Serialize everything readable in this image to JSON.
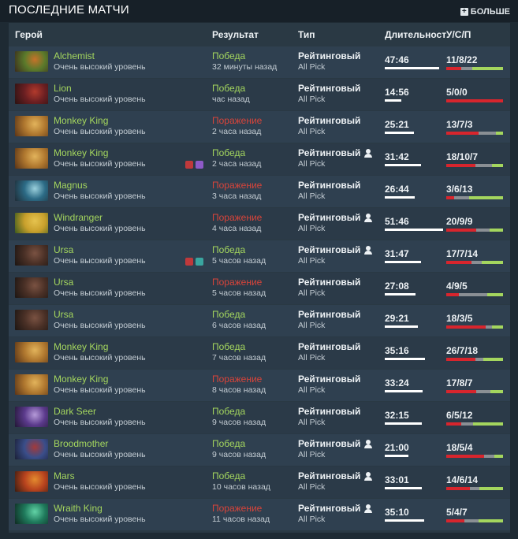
{
  "header": {
    "title": "ПОСЛЕДНИЕ МАТЧИ",
    "more_label": "БОЛЬШЕ"
  },
  "columns": {
    "hero": "Герой",
    "result": "Результат",
    "type": "Тип",
    "duration": "Длительность",
    "kda": "У/С/П"
  },
  "colors": {
    "win": "#a4d65e",
    "loss": "#d9443a",
    "kills": "#d8252d",
    "deaths": "#8a8f94",
    "assists": "#a4d65e"
  },
  "matches": [
    {
      "hero": "Alchemist",
      "skill": "Очень высокий уровень",
      "result": "Победа",
      "outcome": "win",
      "ago": "32 минуты назад",
      "type": "Рейтинговый",
      "party": false,
      "mode": "All Pick",
      "duration": "47:46",
      "duration_fraction": 0.93,
      "kda": "11/8/22",
      "k": 11,
      "d": 8,
      "a": 22,
      "items": [],
      "hero_colors": [
        "#5a7a2b",
        "#c7722a",
        "#3b2c1c"
      ]
    },
    {
      "hero": "Lion",
      "skill": "Очень высокий уровень",
      "result": "Победа",
      "outcome": "win",
      "ago": "час назад",
      "type": "Рейтинговый",
      "party": false,
      "mode": "All Pick",
      "duration": "14:56",
      "duration_fraction": 0.29,
      "kda": "5/0/0",
      "k": 5,
      "d": 0,
      "a": 0,
      "items": [],
      "hero_colors": [
        "#6b1f22",
        "#b23a2c",
        "#2a1212"
      ]
    },
    {
      "hero": "Monkey King",
      "skill": "Очень высокий уровень",
      "result": "Поражение",
      "outcome": "loss",
      "ago": "2 часа назад",
      "type": "Рейтинговый",
      "party": false,
      "mode": "All Pick",
      "duration": "25:21",
      "duration_fraction": 0.5,
      "kda": "13/7/3",
      "k": 13,
      "d": 7,
      "a": 3,
      "items": [],
      "hero_colors": [
        "#b0782f",
        "#e2b35b",
        "#5a3417"
      ]
    },
    {
      "hero": "Monkey King",
      "skill": "Очень высокий уровень",
      "result": "Победа",
      "outcome": "win",
      "ago": "2 часа назад",
      "type": "Рейтинговый",
      "party": true,
      "mode": "All Pick",
      "duration": "31:42",
      "duration_fraction": 0.62,
      "kda": "18/10/7",
      "k": 18,
      "d": 10,
      "a": 7,
      "items": [
        "#c0393b",
        "#8e5ac8"
      ],
      "hero_colors": [
        "#b0782f",
        "#e2b35b",
        "#5a3417"
      ]
    },
    {
      "hero": "Magnus",
      "skill": "Очень высокий уровень",
      "result": "Поражение",
      "outcome": "loss",
      "ago": "3 часа назад",
      "type": "Рейтинговый",
      "party": false,
      "mode": "All Pick",
      "duration": "26:44",
      "duration_fraction": 0.52,
      "kda": "3/6/13",
      "k": 3,
      "d": 6,
      "a": 13,
      "items": [],
      "hero_colors": [
        "#2c6b86",
        "#9ad0dc",
        "#1f2c36"
      ]
    },
    {
      "hero": "Windranger",
      "skill": "Очень высокий уровень",
      "result": "Поражение",
      "outcome": "loss",
      "ago": "4 часа назад",
      "type": "Рейтинговый",
      "party": true,
      "mode": "All Pick",
      "duration": "51:46",
      "duration_fraction": 1.0,
      "kda": "20/9/9",
      "k": 20,
      "d": 9,
      "a": 9,
      "items": [],
      "hero_colors": [
        "#c9a02c",
        "#e6c34f",
        "#3c5a1d"
      ]
    },
    {
      "hero": "Ursa",
      "skill": "Очень высокий уровень",
      "result": "Победа",
      "outcome": "win",
      "ago": "5 часов назад",
      "type": "Рейтинговый",
      "party": true,
      "mode": "All Pick",
      "duration": "31:47",
      "duration_fraction": 0.62,
      "kda": "17/7/14",
      "k": 17,
      "d": 7,
      "a": 14,
      "items": [
        "#c0393b",
        "#3aa6a0"
      ],
      "hero_colors": [
        "#4a3026",
        "#7a5242",
        "#1c1512"
      ]
    },
    {
      "hero": "Ursa",
      "skill": "Очень высокий уровень",
      "result": "Поражение",
      "outcome": "loss",
      "ago": "5 часов назад",
      "type": "Рейтинговый",
      "party": false,
      "mode": "All Pick",
      "duration": "27:08",
      "duration_fraction": 0.53,
      "kda": "4/9/5",
      "k": 4,
      "d": 9,
      "a": 5,
      "items": [],
      "hero_colors": [
        "#4a3026",
        "#7a5242",
        "#1c1512"
      ]
    },
    {
      "hero": "Ursa",
      "skill": "Очень высокий уровень",
      "result": "Победа",
      "outcome": "win",
      "ago": "6 часов назад",
      "type": "Рейтинговый",
      "party": false,
      "mode": "All Pick",
      "duration": "29:21",
      "duration_fraction": 0.57,
      "kda": "18/3/5",
      "k": 18,
      "d": 3,
      "a": 5,
      "items": [],
      "hero_colors": [
        "#4a3026",
        "#7a5242",
        "#1c1512"
      ]
    },
    {
      "hero": "Monkey King",
      "skill": "Очень высокий уровень",
      "result": "Победа",
      "outcome": "win",
      "ago": "7 часов назад",
      "type": "Рейтинговый",
      "party": false,
      "mode": "All Pick",
      "duration": "35:16",
      "duration_fraction": 0.69,
      "kda": "26/7/18",
      "k": 26,
      "d": 7,
      "a": 18,
      "items": [],
      "hero_colors": [
        "#b0782f",
        "#e2b35b",
        "#5a3417"
      ]
    },
    {
      "hero": "Monkey King",
      "skill": "Очень высокий уровень",
      "result": "Поражение",
      "outcome": "loss",
      "ago": "8 часов назад",
      "type": "Рейтинговый",
      "party": false,
      "mode": "All Pick",
      "duration": "33:24",
      "duration_fraction": 0.65,
      "kda": "17/8/7",
      "k": 17,
      "d": 8,
      "a": 7,
      "items": [],
      "hero_colors": [
        "#b0782f",
        "#e2b35b",
        "#5a3417"
      ]
    },
    {
      "hero": "Dark Seer",
      "skill": "Очень высокий уровень",
      "result": "Победа",
      "outcome": "win",
      "ago": "9 часов назад",
      "type": "Рейтинговый",
      "party": false,
      "mode": "All Pick",
      "duration": "32:15",
      "duration_fraction": 0.63,
      "kda": "6/5/12",
      "k": 6,
      "d": 5,
      "a": 12,
      "items": [],
      "hero_colors": [
        "#5b3a8c",
        "#b59ad8",
        "#221634"
      ]
    },
    {
      "hero": "Broodmother",
      "skill": "Очень высокий уровень",
      "result": "Победа",
      "outcome": "win",
      "ago": "9 часов назад",
      "type": "Рейтинговый",
      "party": true,
      "mode": "All Pick",
      "duration": "21:00",
      "duration_fraction": 0.41,
      "kda": "18/5/4",
      "k": 18,
      "d": 5,
      "a": 4,
      "items": [],
      "hero_colors": [
        "#3a4e8a",
        "#a33a3a",
        "#1b2036"
      ]
    },
    {
      "hero": "Mars",
      "skill": "Очень высокий уровень",
      "result": "Победа",
      "outcome": "win",
      "ago": "10 часов назад",
      "type": "Рейтинговый",
      "party": true,
      "mode": "All Pick",
      "duration": "33:01",
      "duration_fraction": 0.64,
      "kda": "14/6/14",
      "k": 14,
      "d": 6,
      "a": 14,
      "items": [],
      "hero_colors": [
        "#b8431e",
        "#e38b2f",
        "#3a1c10"
      ]
    },
    {
      "hero": "Wraith King",
      "skill": "Очень высокий уровень",
      "result": "Поражение",
      "outcome": "loss",
      "ago": "11 часов назад",
      "type": "Рейтинговый",
      "party": true,
      "mode": "All Pick",
      "duration": "35:10",
      "duration_fraction": 0.68,
      "kda": "5/4/7",
      "k": 5,
      "d": 4,
      "a": 7,
      "items": [],
      "hero_colors": [
        "#1f7a5c",
        "#62d3a6",
        "#0f2a22"
      ]
    }
  ]
}
